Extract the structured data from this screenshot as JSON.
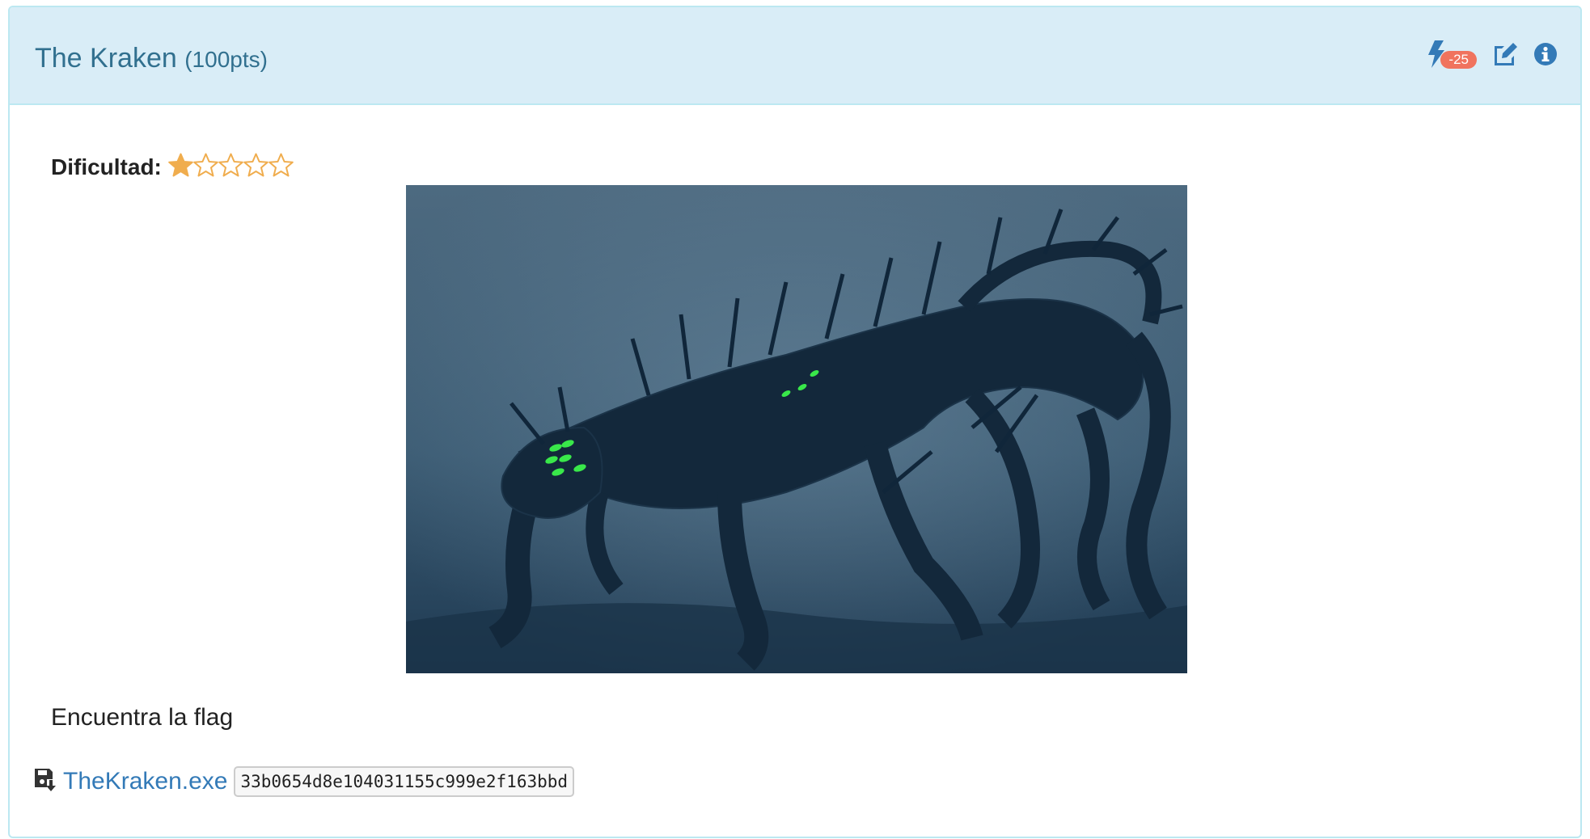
{
  "challenge": {
    "name": "The Kraken",
    "points": "(100pts)",
    "badge": "-25",
    "difficulty_label": "Dificultad:",
    "difficulty_rating": 1,
    "difficulty_max": 5,
    "description": "Encuentra la flag",
    "file_name": "TheKraken.exe",
    "file_hash": "33b0654d8e104031155c999e2f163bbd"
  },
  "icons": {
    "lightning": "bolt-icon",
    "edit": "edit-icon",
    "info": "info-circle-icon",
    "download": "file-download-icon",
    "star_full": "star-filled-icon",
    "star_empty": "star-outline-icon"
  },
  "colors": {
    "heading_bg": "#d9edf7",
    "heading_border": "#bce8f1",
    "title": "#31708f",
    "badge": "#f0735e",
    "star": "#f0ad4e",
    "link": "#337ab7"
  }
}
